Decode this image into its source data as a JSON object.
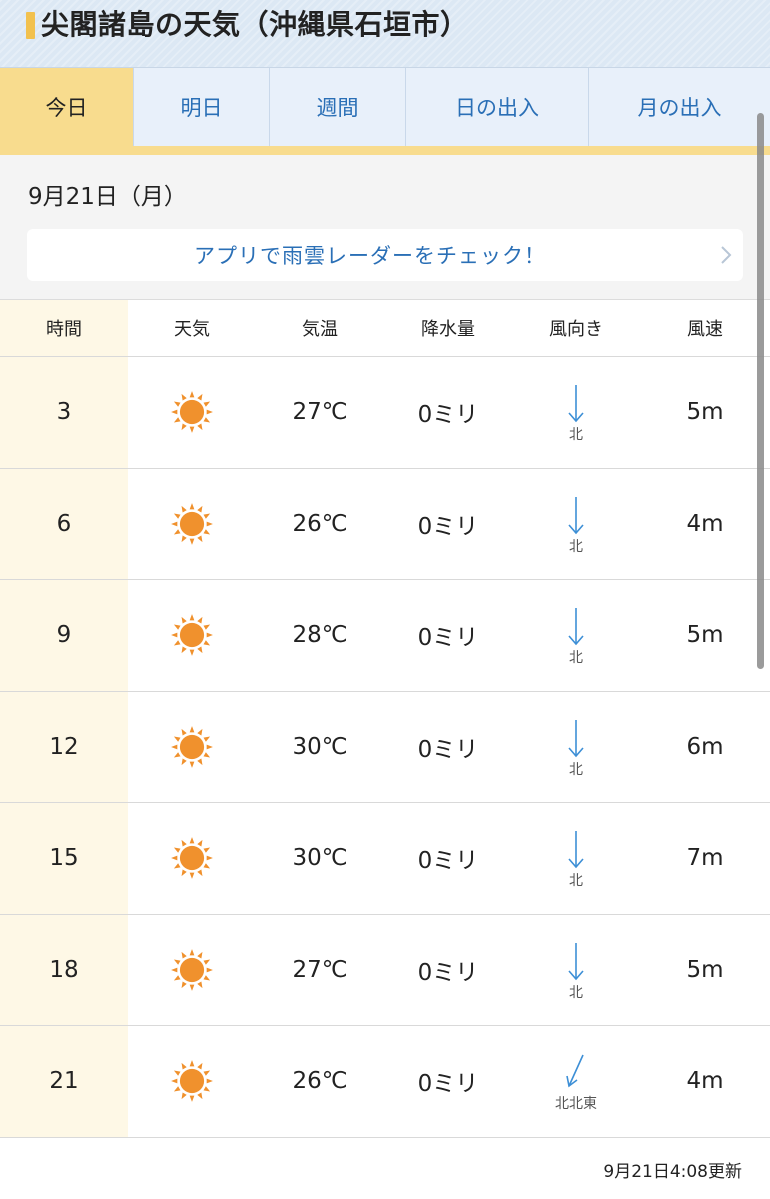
{
  "header": {
    "title": "尖閣諸島の天気（沖縄県石垣市）"
  },
  "tabs": [
    {
      "label": "今日",
      "active": true
    },
    {
      "label": "明日",
      "active": false
    },
    {
      "label": "週間",
      "active": false
    },
    {
      "label": "日の出入",
      "active": false
    },
    {
      "label": "月の出入",
      "active": false
    }
  ],
  "date": "9月21日（月）",
  "app_banner": {
    "label": "アプリで雨雲レーダーをチェック！",
    "icon": "chevron-right-icon"
  },
  "table": {
    "headers": {
      "time": "時間",
      "weather": "天気",
      "temperature": "気温",
      "precipitation": "降水量",
      "wind_direction": "風向き",
      "wind_speed": "風速"
    },
    "rows": [
      {
        "time": "3",
        "weather_icon": "sun-icon",
        "temperature": "27℃",
        "precipitation": "0ミリ",
        "wind_direction": "北",
        "wind_speed": "5m"
      },
      {
        "time": "6",
        "weather_icon": "sun-icon",
        "temperature": "26℃",
        "precipitation": "0ミリ",
        "wind_direction": "北",
        "wind_speed": "4m"
      },
      {
        "time": "9",
        "weather_icon": "sun-icon",
        "temperature": "28℃",
        "precipitation": "0ミリ",
        "wind_direction": "北",
        "wind_speed": "5m"
      },
      {
        "time": "12",
        "weather_icon": "sun-icon",
        "temperature": "30℃",
        "precipitation": "0ミリ",
        "wind_direction": "北",
        "wind_speed": "6m"
      },
      {
        "time": "15",
        "weather_icon": "sun-icon",
        "temperature": "30℃",
        "precipitation": "0ミリ",
        "wind_direction": "北",
        "wind_speed": "7m"
      },
      {
        "time": "18",
        "weather_icon": "sun-icon",
        "temperature": "27℃",
        "precipitation": "0ミリ",
        "wind_direction": "北",
        "wind_speed": "5m"
      },
      {
        "time": "21",
        "weather_icon": "sun-icon",
        "temperature": "26℃",
        "precipitation": "0ミリ",
        "wind_direction": "北北東",
        "wind_speed": "4m"
      }
    ]
  },
  "updated": "9月21日4:08更新",
  "colors": {
    "accent_blue": "#2a6fb6",
    "active_tab": "#f8dc8e",
    "sun": "#f0912d",
    "arrow": "#3d8fd6"
  }
}
